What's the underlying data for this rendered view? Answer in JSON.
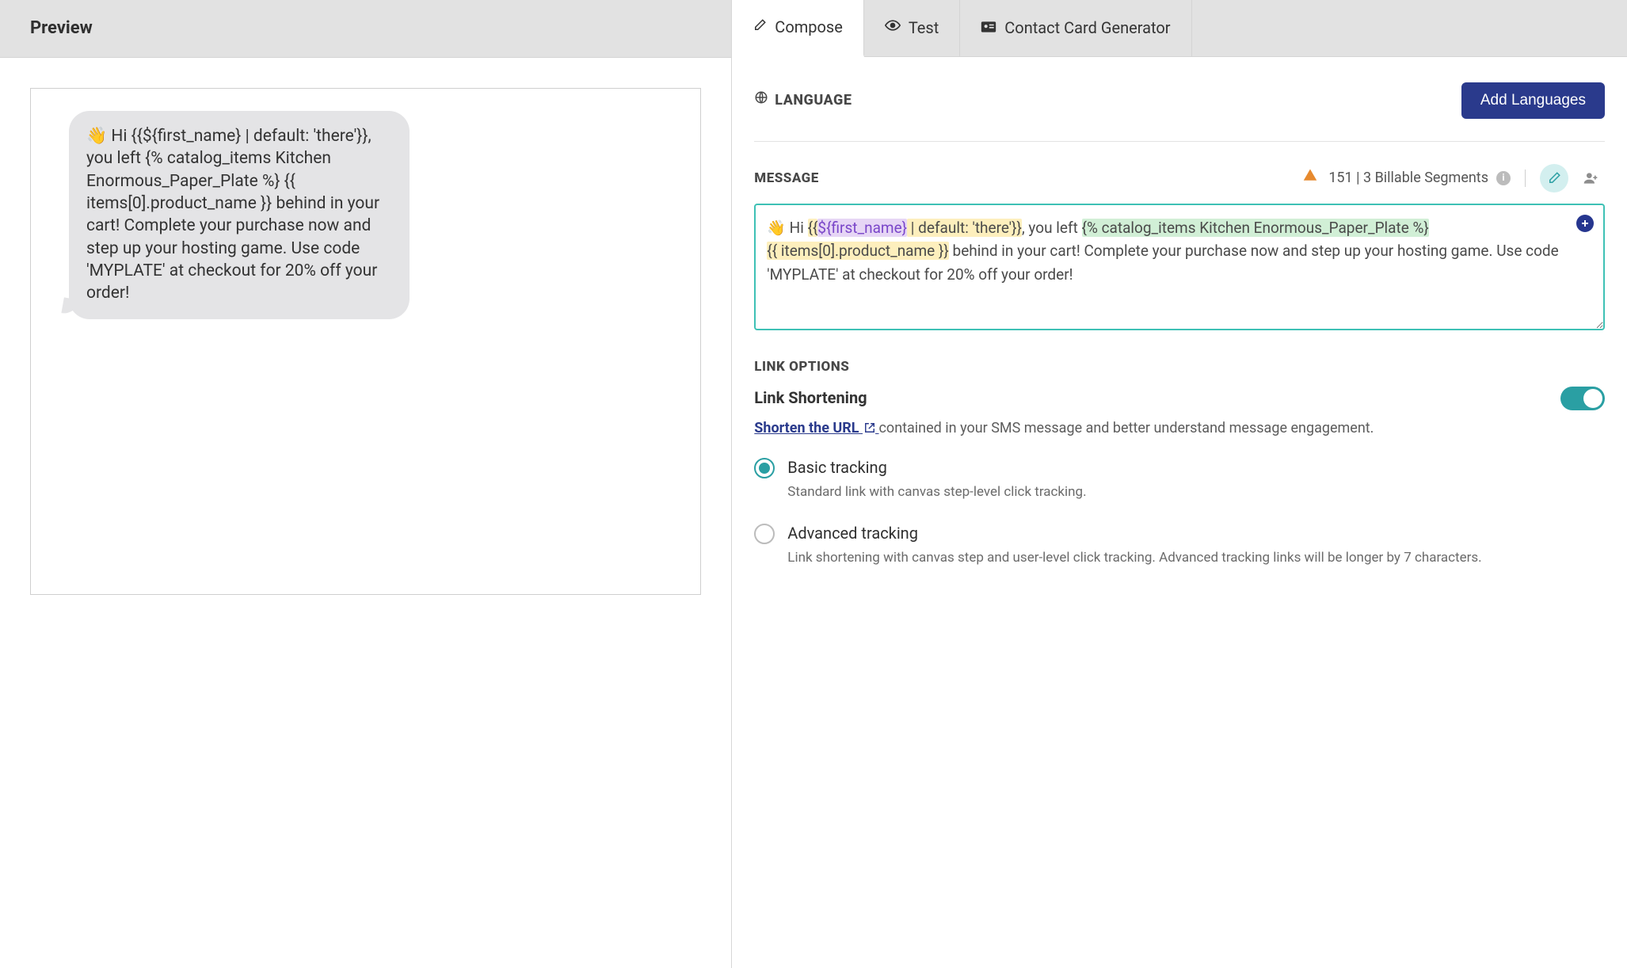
{
  "preview": {
    "header": "Preview",
    "bubble_text": "👋 Hi {{${first_name} | default: 'there'}}, you left {% catalog_items Kitchen Enormous_Paper_Plate %}\n{{ items[0].product_name }} behind in your cart! Complete your purchase now and step up your hosting game. Use code 'MYPLATE' at checkout for 20% off your order!"
  },
  "tabs": {
    "compose": "Compose",
    "test": "Test",
    "contact_card": "Contact Card Generator"
  },
  "language": {
    "label": "LANGUAGE",
    "button": "Add Languages"
  },
  "message": {
    "label": "MESSAGE",
    "count_text": "151 | 3 Billable Segments",
    "editor_plain": "👋 Hi {{${first_name} | default: 'there'}}, you left {% catalog_items Kitchen Enormous_Paper_Plate %}\n{{ items[0].product_name }} behind in your cart! Complete your purchase now and step up your hosting game. Use code 'MYPLATE' at checkout for 20% off your order!",
    "editor_segments": [
      {
        "text": "👋 Hi ",
        "class": ""
      },
      {
        "text": "{{",
        "class": "hl-yellow"
      },
      {
        "text": "${first_name}",
        "class": "hl-purple"
      },
      {
        "text": " | default: 'there'}}",
        "class": "hl-yellow"
      },
      {
        "text": ", you left ",
        "class": ""
      },
      {
        "text": "{% catalog_items Kitchen Enormous_Paper_Plate %}",
        "class": "hl-green"
      },
      {
        "text": "\n",
        "class": ""
      },
      {
        "text": "{{ items[0].product_name }}",
        "class": "hl-yellow"
      },
      {
        "text": " behind in your cart! Complete your purchase now and step up your hosting game. Use code 'MYPLATE' at checkout for 20% off your order!",
        "class": ""
      }
    ]
  },
  "link_options": {
    "label": "LINK OPTIONS",
    "title": "Link Shortening",
    "toggle_on": true,
    "link_text": "Shorten the URL",
    "desc_after": "contained in your SMS message and better understand message engagement.",
    "radios": [
      {
        "id": "basic",
        "title": "Basic tracking",
        "sub": "Standard link with canvas step-level click tracking.",
        "checked": true
      },
      {
        "id": "advanced",
        "title": "Advanced tracking",
        "sub": "Link shortening with canvas step and user-level click tracking. Advanced tracking links will be longer by 7 characters.",
        "checked": false
      }
    ]
  }
}
